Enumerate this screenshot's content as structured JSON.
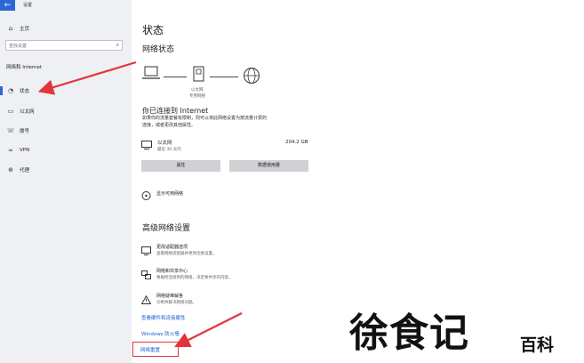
{
  "window": {
    "title": "设置",
    "back_icon": "arrow-left-icon"
  },
  "sidebar": {
    "home_label": "主页",
    "search_placeholder": "查找设置",
    "section": "网络和 Internet",
    "items": [
      {
        "icon": "globe-status-icon",
        "label": "状态",
        "active": true
      },
      {
        "icon": "ethernet-icon",
        "label": "以太网"
      },
      {
        "icon": "dialup-icon",
        "label": "拨号"
      },
      {
        "icon": "vpn-icon",
        "label": "VPN"
      },
      {
        "icon": "proxy-icon",
        "label": "代理"
      }
    ]
  },
  "main": {
    "title": "状态",
    "network_status_heading": "网络状态",
    "diagram": {
      "label_line1": "以太网",
      "label_line2": "专用网络"
    },
    "connected_heading": "你已连接到 Internet",
    "connected_desc_line1": "如果你的流量套餐有限制，则可以将此网络设置为按流量计费的",
    "connected_desc_line2": "连接，或者更改其他属性。",
    "ethernet": {
      "name": "以太网",
      "time": "最近 30 天内",
      "usage": "204.2 GB"
    },
    "buttons": {
      "properties": "属性",
      "data_usage": "数据使用量"
    },
    "show_available": "显示可用网络",
    "advanced_heading": "高级网络设置",
    "advanced_items": [
      {
        "icon": "adapter-icon",
        "title": "更改适配器选项",
        "desc": "查看网络适配器并更改连接设置。"
      },
      {
        "icon": "sharing-icon",
        "title": "网络和共享中心",
        "desc": "根据所连接到的网络，决定要共享的内容。"
      },
      {
        "icon": "warning-icon",
        "title": "网络疑难解答",
        "desc": "诊断并解决网络问题。"
      }
    ],
    "links": {
      "hardware": "查看硬件和连接属性",
      "firewall": "Windows 防火墙",
      "reset": "网络重置"
    }
  },
  "watermark": {
    "main": "徐食记",
    "sub": "百科"
  },
  "colors": {
    "accent": "#2b67d6",
    "link": "#1a5fd0",
    "arrow": "#e0353b",
    "sidebar_bg": "#eef0f3",
    "button_bg": "#cfd1d4"
  }
}
